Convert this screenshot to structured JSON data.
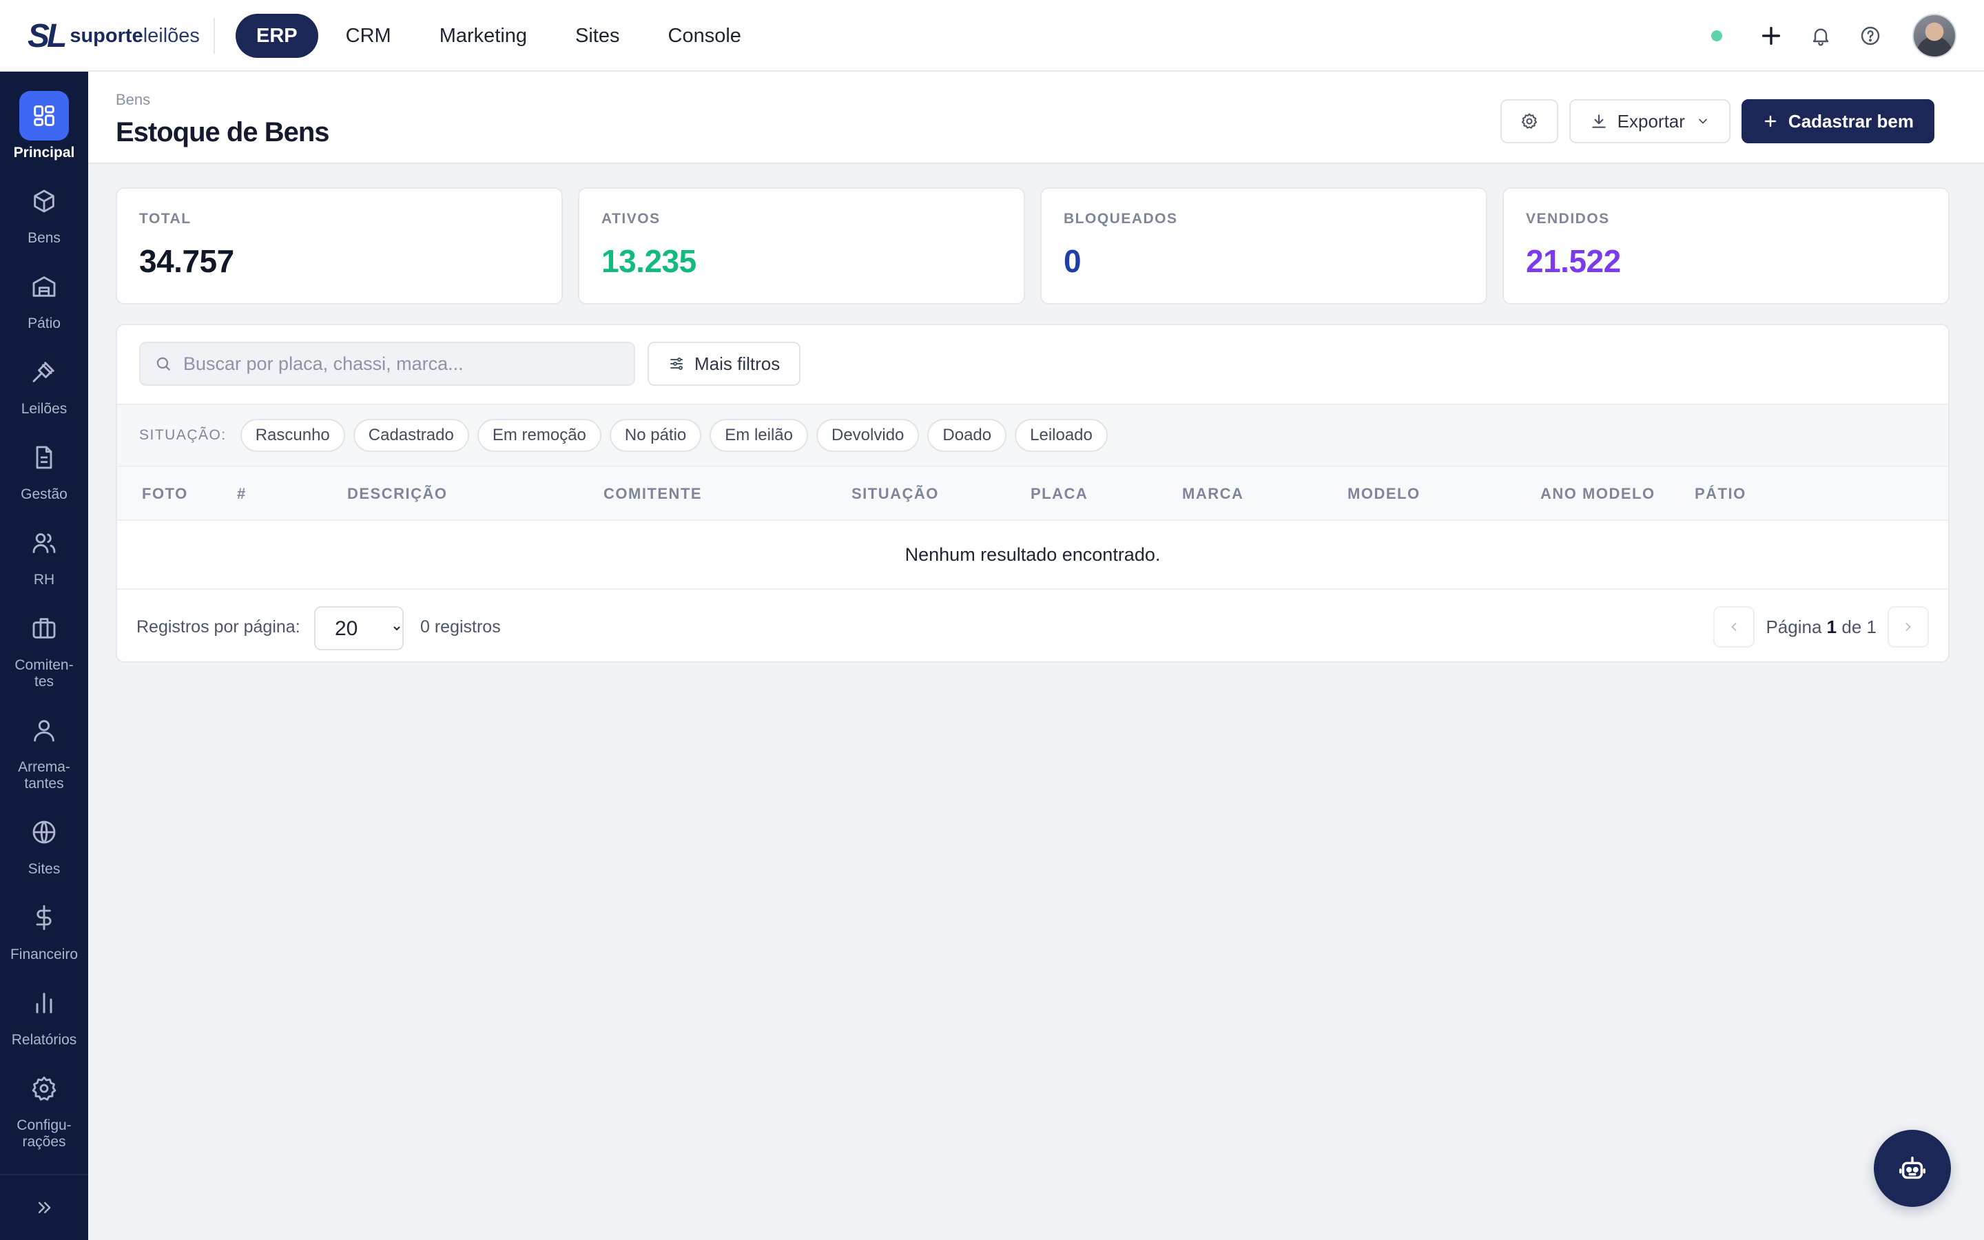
{
  "brand": {
    "mark": "SL",
    "name_bold": "suporte",
    "name_light": "leilões"
  },
  "modules": [
    {
      "label": "ERP",
      "active": true
    },
    {
      "label": "CRM",
      "active": false
    },
    {
      "label": "Marketing",
      "active": false
    },
    {
      "label": "Sites",
      "active": false
    },
    {
      "label": "Console",
      "active": false
    }
  ],
  "topbar_icons": [
    "status-dot",
    "plus-icon",
    "bell-icon",
    "help-icon",
    "user-avatar"
  ],
  "sidebar": {
    "items": [
      {
        "label": "Principal",
        "icon": "grid-icon",
        "active": true
      },
      {
        "label": "Bens",
        "icon": "box-icon"
      },
      {
        "label": "Pátio",
        "icon": "building-icon"
      },
      {
        "label": "Leilões",
        "icon": "gavel-icon"
      },
      {
        "label": "Gestão",
        "icon": "document-icon"
      },
      {
        "label": "RH",
        "icon": "users-icon"
      },
      {
        "label": "Comiten-\ntes",
        "icon": "briefcase-icon"
      },
      {
        "label": "Arrema-\ntantes",
        "icon": "user-icon"
      },
      {
        "label": "Sites",
        "icon": "globe-icon"
      },
      {
        "label": "Financeiro",
        "icon": "dollar-icon"
      },
      {
        "label": "Relatórios",
        "icon": "bar-chart-icon"
      },
      {
        "label": "Configu-\nrações",
        "icon": "settings-icon"
      }
    ],
    "collapse_icon": "chevrons-right-icon"
  },
  "header": {
    "breadcrumb": "Bens",
    "title": "Estoque de Bens",
    "export_label": "Exportar",
    "create_label": "Cadastrar bem"
  },
  "stats": [
    {
      "label": "TOTAL",
      "value": "34.757",
      "color": "#101828"
    },
    {
      "label": "ATIVOS",
      "value": "13.235",
      "color": "#12b981"
    },
    {
      "label": "BLOQUEADOS",
      "value": "0",
      "color": "#1e3fa8"
    },
    {
      "label": "VENDIDOS",
      "value": "21.522",
      "color": "#7c3aed"
    }
  ],
  "filters": {
    "search_placeholder": "Buscar por placa, chassi, marca...",
    "more_filters_label": "Mais filtros",
    "situation_label": "SITUAÇÃO:",
    "situations": [
      "Rascunho",
      "Cadastrado",
      "Em remoção",
      "No pátio",
      "Em leilão",
      "Devolvido",
      "Doado",
      "Leiloado"
    ]
  },
  "table": {
    "columns": [
      "FOTO",
      "#",
      "DESCRIÇÃO",
      "COMITENTE",
      "SITUAÇÃO",
      "PLACA",
      "MARCA",
      "MODELO",
      "ANO MODELO",
      "PÁTIO"
    ],
    "empty_message": "Nenhum resultado encontrado."
  },
  "pagination": {
    "per_page_label": "Registros por página:",
    "per_page_value": "20",
    "per_page_options": [
      "20"
    ],
    "records_text": "0 registros",
    "page_prefix": "Página",
    "current_page": "1",
    "page_separator": "de",
    "total_pages": "1"
  },
  "fab_icon": "robot-icon"
}
